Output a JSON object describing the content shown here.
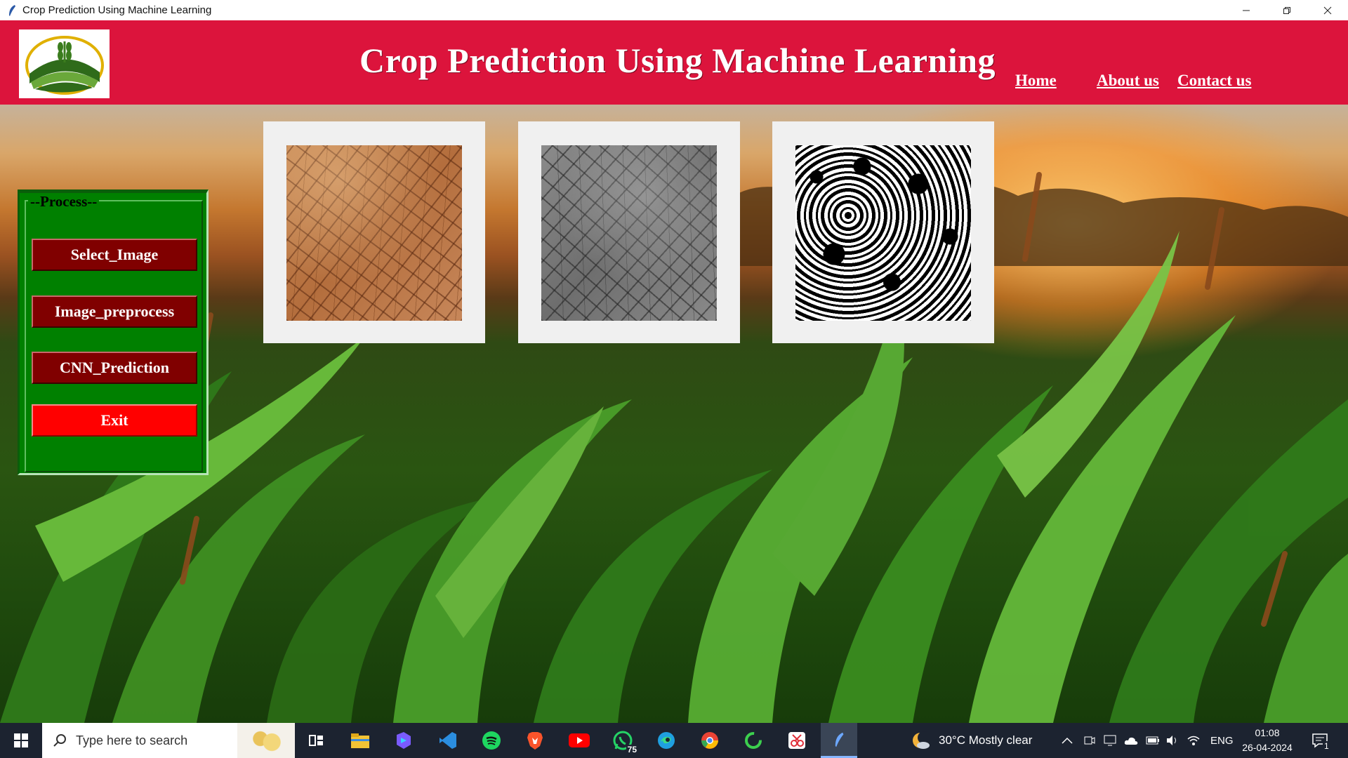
{
  "window": {
    "title": "Crop Prediction Using Machine Learning"
  },
  "header": {
    "heading": "Crop Prediction Using Machine Learning",
    "nav": [
      {
        "label": "Home"
      },
      {
        "label": "About us"
      },
      {
        "label": "Contact us"
      }
    ],
    "colors": {
      "header_bg": "#dc143c",
      "text": "#ffffff"
    }
  },
  "process_panel": {
    "legend": "--Process--",
    "buttons": [
      {
        "label": "Select_Image"
      },
      {
        "label": "Image_preprocess"
      },
      {
        "label": "CNN_Prediction"
      },
      {
        "label": "Exit"
      }
    ],
    "colors": {
      "panel_bg": "#008000",
      "button_bg": "#800000",
      "exit_bg": "#ff0000"
    }
  },
  "images": [
    {
      "content": "original soil image (cracked brown soil)"
    },
    {
      "content": "grayscale soil image"
    },
    {
      "content": "binary thresholded soil image"
    }
  ],
  "taskbar": {
    "search_placeholder": "Type here to search",
    "pinned_icons": [
      "task-view-icon",
      "file-explorer-icon",
      "copilot-icon",
      "vscode-icon",
      "spotify-icon",
      "brave-icon",
      "youtube-icon",
      "whatsapp-icon",
      "edge-icon",
      "chrome-icon",
      "green-ring-app-icon",
      "snipping-tool-icon",
      "python-feather-icon"
    ],
    "whatsapp_badge": "75",
    "weather": "30°C  Mostly clear",
    "language": "ENG",
    "time": "01:08",
    "date": "26-04-2024",
    "notification_count": "1"
  }
}
